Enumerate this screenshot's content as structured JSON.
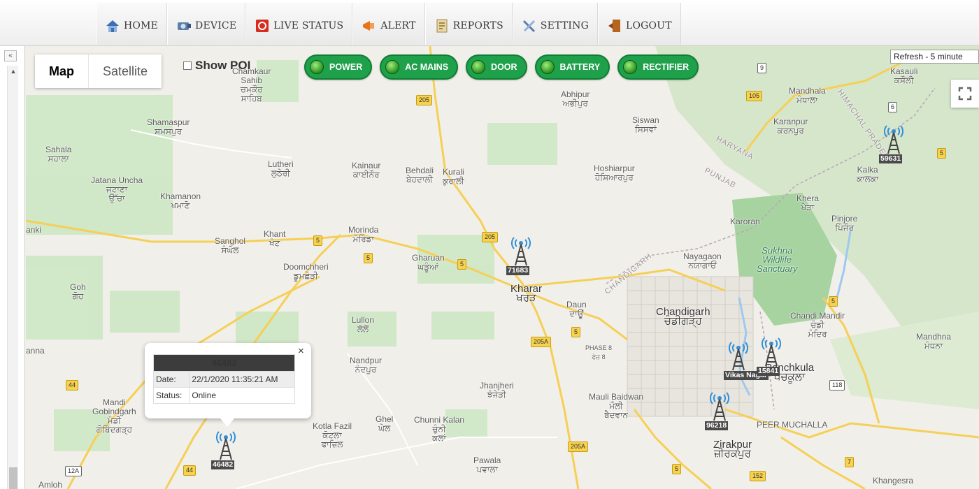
{
  "nav": {
    "items": [
      {
        "label": "HOME",
        "icon": "home-icon"
      },
      {
        "label": "DEVICE",
        "icon": "device-icon"
      },
      {
        "label": "LIVE STATUS",
        "icon": "live-status-icon"
      },
      {
        "label": "ALERT",
        "icon": "alert-icon"
      },
      {
        "label": "REPORTS",
        "icon": "reports-icon"
      },
      {
        "label": "SETTING",
        "icon": "setting-icon"
      },
      {
        "label": "LOGOUT",
        "icon": "logout-icon"
      }
    ]
  },
  "sidebar": {
    "collapse_label": "«"
  },
  "map": {
    "type_map": "Map",
    "type_satellite": "Satellite",
    "show_poi": "Show POI",
    "refresh": "Refresh - 5 minute",
    "legend": [
      "POWER",
      "AC MAINS",
      "DOOR",
      "BATTERY",
      "RECTIFIER"
    ],
    "legend_color": "#1fa04a",
    "places": [
      {
        "name": "Chamkaur\nSahib\nਚਮਕੌਰ\nਸਾਹਿਬ",
        "cls": ""
      },
      {
        "name": "Shamaspur\nਸ਼ਮਸਪੁਰ",
        "cls": ""
      },
      {
        "name": "Sahala\nਸਹਾਲਾ",
        "cls": ""
      },
      {
        "name": "Jatana Uncha\nਜਟਾਣਾ\nਉੱਚਾ",
        "cls": ""
      },
      {
        "name": "Khamanon\nਖਮਾਣੋ",
        "cls": ""
      },
      {
        "name": "Lutheri\nਲੁਠੇਰੀ",
        "cls": ""
      },
      {
        "name": "Kainaur\nਕਾਈਨੌਰ",
        "cls": ""
      },
      {
        "name": "Behdali\nਬੇਹਦਾਲੀ",
        "cls": ""
      },
      {
        "name": "Kurali\nਕੁਰਾਲੀ",
        "cls": ""
      },
      {
        "name": "Abhipur\nਅਭੀਪੁਰ",
        "cls": ""
      },
      {
        "name": "Siswan\nਸਿਸਵਾਂ",
        "cls": ""
      },
      {
        "name": "Hoshiarpur\nਹੋਸ਼ਿਆਰਪੁਰ",
        "cls": ""
      },
      {
        "name": "Mandhala\nਮੰਧਾਲਾ",
        "cls": ""
      },
      {
        "name": "Karanpur\nਕਰਨਪੁਰ",
        "cls": ""
      },
      {
        "name": "Kasauli\nਕਸੌਲੀ",
        "cls": ""
      },
      {
        "name": "Kalka\nਕਾਲਕਾ",
        "cls": ""
      },
      {
        "name": "Khera\nਖੇੜਾ",
        "cls": ""
      },
      {
        "name": "Pinjore\nਪਿੰਜੌਰ",
        "cls": ""
      },
      {
        "name": "Karoran",
        "cls": ""
      },
      {
        "name": "Nayagaon\nਨਯਾਗਾਓਂ",
        "cls": ""
      },
      {
        "name": "Sukhna\nWildlife\nSanctuary",
        "cls": "park"
      },
      {
        "name": "Chandigarh\nਚੰਡੀਗੜ੍ਹ",
        "cls": "big"
      },
      {
        "name": "Chandi Mandir\nਚੰਡੀ\nਮੰਦਿਰ",
        "cls": ""
      },
      {
        "name": "Mandhna\nਮੰਧਨਾ",
        "cls": ""
      },
      {
        "name": "Morinda\nਮੋਰਿੰਡਾ",
        "cls": ""
      },
      {
        "name": "Sanghol\nਸੰਘੋਲ",
        "cls": ""
      },
      {
        "name": "Khant\nਖੰਟ",
        "cls": ""
      },
      {
        "name": "Doomchheri\nਡੂਮਛੇੜੀ",
        "cls": ""
      },
      {
        "name": "Gharuan\nਘੜੂੰਆਂ",
        "cls": ""
      },
      {
        "name": "Kharar\nਖਰੜ",
        "cls": "big"
      },
      {
        "name": "Daun\nਦਾਊਂ",
        "cls": ""
      },
      {
        "name": "Goh\nਗੋਹ",
        "cls": ""
      },
      {
        "name": "Lullon\nਲੱਲੋਂ",
        "cls": ""
      },
      {
        "name": "Nandpur\nਨੰਦਪੁਰ",
        "cls": ""
      },
      {
        "name": "Jhanjheri\nਝੰਜੇੜੀ",
        "cls": ""
      },
      {
        "name": "Mauli Baidwan\nਮੌਲੀ\nਬੈਦਵਾਨ",
        "cls": ""
      },
      {
        "name": "Zirakpur\nਜ਼ੀਰਕਪੁਰ",
        "cls": "big"
      },
      {
        "name": "PEER MUCHALLA",
        "cls": ""
      },
      {
        "name": "Mandi\nGobindgarh\nਮੰਡੀ\nਗੋਬਿੰਦਗੜ੍ਹ",
        "cls": ""
      },
      {
        "name": "Kotla Fazil\nਕੋਟਲਾ\nਫਾਜ਼ਿਲ",
        "cls": ""
      },
      {
        "name": "Ghel\nਘੇਲ",
        "cls": ""
      },
      {
        "name": "Chunni Kalan\nਚੁੰਨੀ\nਕਲਾਂ",
        "cls": ""
      },
      {
        "name": "Pawala\nਪਵਾਲਾ",
        "cls": ""
      },
      {
        "name": "Khangesra",
        "cls": ""
      },
      {
        "name": "HARYANA",
        "cls": "tilt"
      },
      {
        "name": "PUNJAB",
        "cls": "tilt"
      },
      {
        "name": "CHANDIGARH",
        "cls": "tilt"
      },
      {
        "name": "HIMACHAL PRADESH",
        "cls": "tilt"
      },
      {
        "name": "PHASE 8\nਫੇਜ਼ 8",
        "cls": ""
      },
      {
        "name": "Panchkula\nਪੰਚਕੂਲਾ",
        "cls": "big"
      },
      {
        "name": "Amloh",
        "cls": ""
      },
      {
        "name": "anna",
        "cls": ""
      },
      {
        "name": "anki",
        "cls": ""
      }
    ],
    "shields": [
      "205",
      "105",
      "6",
      "5",
      "5",
      "5",
      "5",
      "205",
      "205A",
      "5",
      "5",
      "44",
      "44",
      "12A",
      "205A",
      "5",
      "152",
      "7",
      "118",
      "9"
    ],
    "towers": [
      {
        "id": "46482"
      },
      {
        "id": "71683"
      },
      {
        "id": "59631"
      },
      {
        "id": "Vikas Nagar"
      },
      {
        "id": "15841"
      },
      {
        "id": "96218"
      }
    ]
  },
  "infowindow": {
    "title": "46482",
    "date_label": "Date:",
    "date_value": "22/1/2020 11:35:21 AM",
    "status_label": "Status:",
    "status_value": "Online",
    "close": "×"
  }
}
